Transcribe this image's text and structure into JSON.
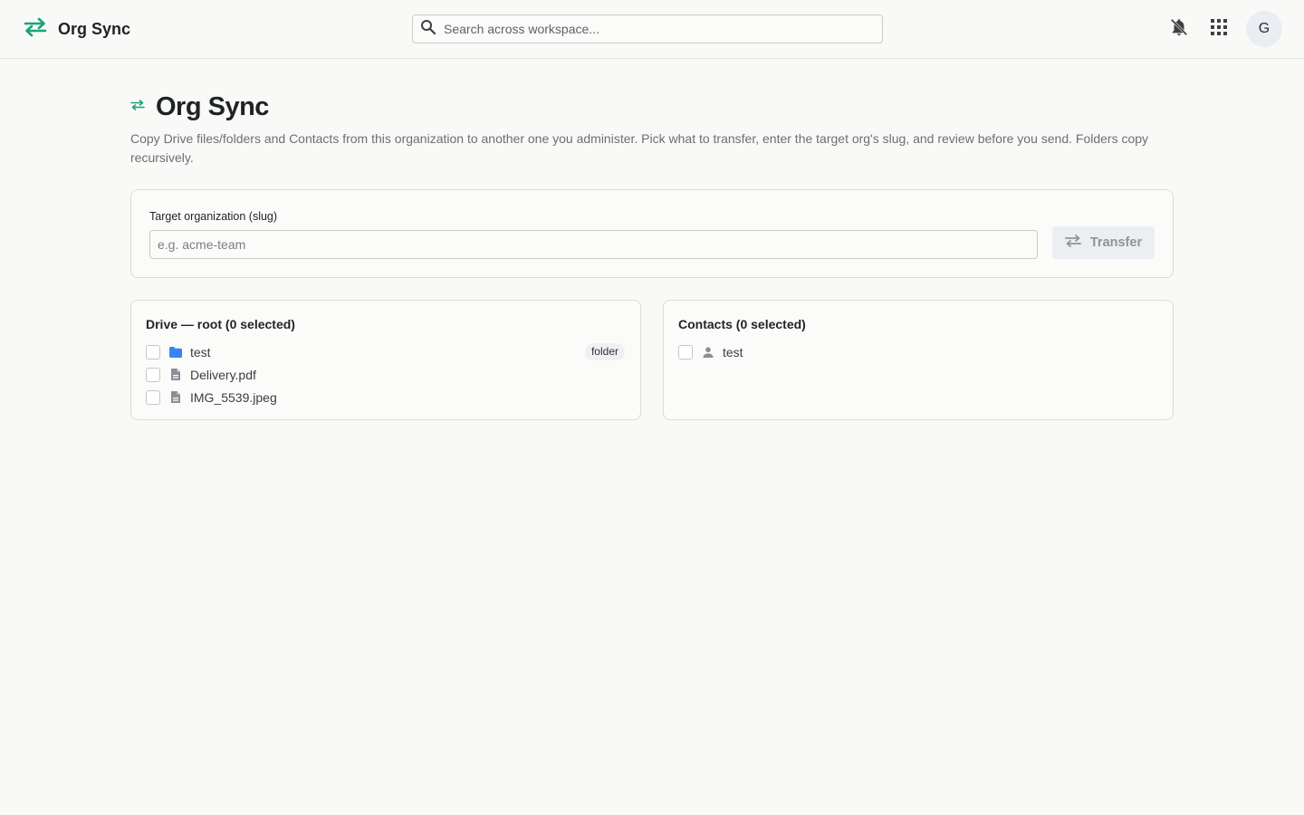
{
  "app": {
    "title": "Org Sync",
    "accent_color": "#1aa37a",
    "logo_icon": "sync-arrows-icon"
  },
  "search": {
    "placeholder": "Search across workspace..."
  },
  "topbar": {
    "notifications_icon": "bell-off-icon",
    "apps_icon": "grid-apps-icon",
    "avatar_initial": "G"
  },
  "page": {
    "title": "Org Sync",
    "description": "Copy Drive files/folders and Contacts from this organization to another one you administer. Pick what to transfer, enter the target org's slug, and review before you send. Folders copy recursively."
  },
  "target": {
    "label": "Target organization (slug)",
    "placeholder": "e.g. acme-team",
    "value": "",
    "transfer_label": "Transfer",
    "transfer_disabled": true
  },
  "drive": {
    "title": "Drive — root (0 selected)",
    "items": [
      {
        "name": "test",
        "icon": "folder-icon",
        "badge": "folder",
        "checked": false
      },
      {
        "name": "Delivery.pdf",
        "icon": "file-icon",
        "checked": false
      },
      {
        "name": "IMG_5539.jpeg",
        "icon": "file-icon",
        "checked": false
      }
    ]
  },
  "contacts": {
    "title": "Contacts (0 selected)",
    "items": [
      {
        "name": "test",
        "icon": "person-icon",
        "checked": false
      }
    ]
  }
}
